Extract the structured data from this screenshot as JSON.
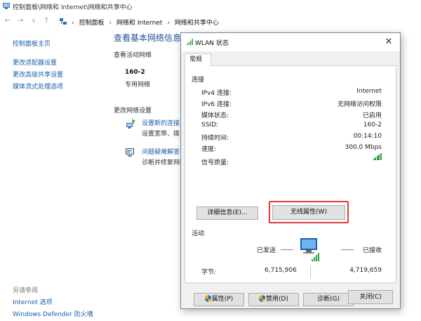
{
  "window": {
    "title": "控制面板\\网络和 Internet\\网络和共享中心"
  },
  "navbar": {
    "back": "←",
    "forward": "→",
    "recent": "∨",
    "up": "↑",
    "breadcrumb": [
      "控制面板",
      "网络和 Internet",
      "网络和共享中心"
    ],
    "separator": "›"
  },
  "sidebar": {
    "links": [
      "控制面板主页",
      "更改适配器设置",
      "更改高级共享设置",
      "媒体流式处理选项"
    ],
    "see_also_heading": "另请参阅",
    "see_also": [
      "Internet 选项",
      "Windows Defender 防火墙"
    ]
  },
  "main": {
    "title": "查看基本网络信息并设置连接",
    "active_networks_label": "查看活动网络",
    "network_name": "160-2",
    "network_type": "专用网络",
    "change_settings_label": "更改网络设置",
    "tasks": [
      {
        "link": "设置新的连接或网络",
        "desc": "设置宽带、拨号或 VPN 连接"
      },
      {
        "link": "问题疑难解答",
        "desc": "诊断并修复网络问题"
      }
    ]
  },
  "dialog": {
    "title": "WLAN 状态",
    "tab": "常规",
    "connection_heading": "连接",
    "rows": [
      {
        "label": "IPv4 连接:",
        "value": "Internet"
      },
      {
        "label": "IPv6 连接:",
        "value": "无网络访问权限"
      },
      {
        "label": "媒体状态:",
        "value": "已启用"
      },
      {
        "label": "SSID:",
        "value": "160-2"
      },
      {
        "label": "持续时间:",
        "value": "00:14:10"
      },
      {
        "label": "速度:",
        "value": "300.0 Mbps"
      }
    ],
    "signal_label": "信号质量:",
    "signal_quality": {
      "bars_lit": 5,
      "bars_total": 5
    },
    "details_button": "详细信息(E)...",
    "wireless_button": "无线属性(W)",
    "activity_heading": "活动",
    "sent_label": "已发送",
    "received_label": "已接收",
    "bytes_label": "字节:",
    "bytes_sent": "6,715,906",
    "bytes_received": "4,719,659",
    "properties_button": "属性(P)",
    "disable_button": "禁用(D)",
    "diagnose_button": "诊断(G)",
    "close_button": "关闭(C)",
    "close_glyph": "✕"
  },
  "colors": {
    "link_blue": "#1a5ea8",
    "title_blue": "#1d4f9a",
    "highlight_red": "#e53935",
    "signal_green": "#2ea043"
  }
}
